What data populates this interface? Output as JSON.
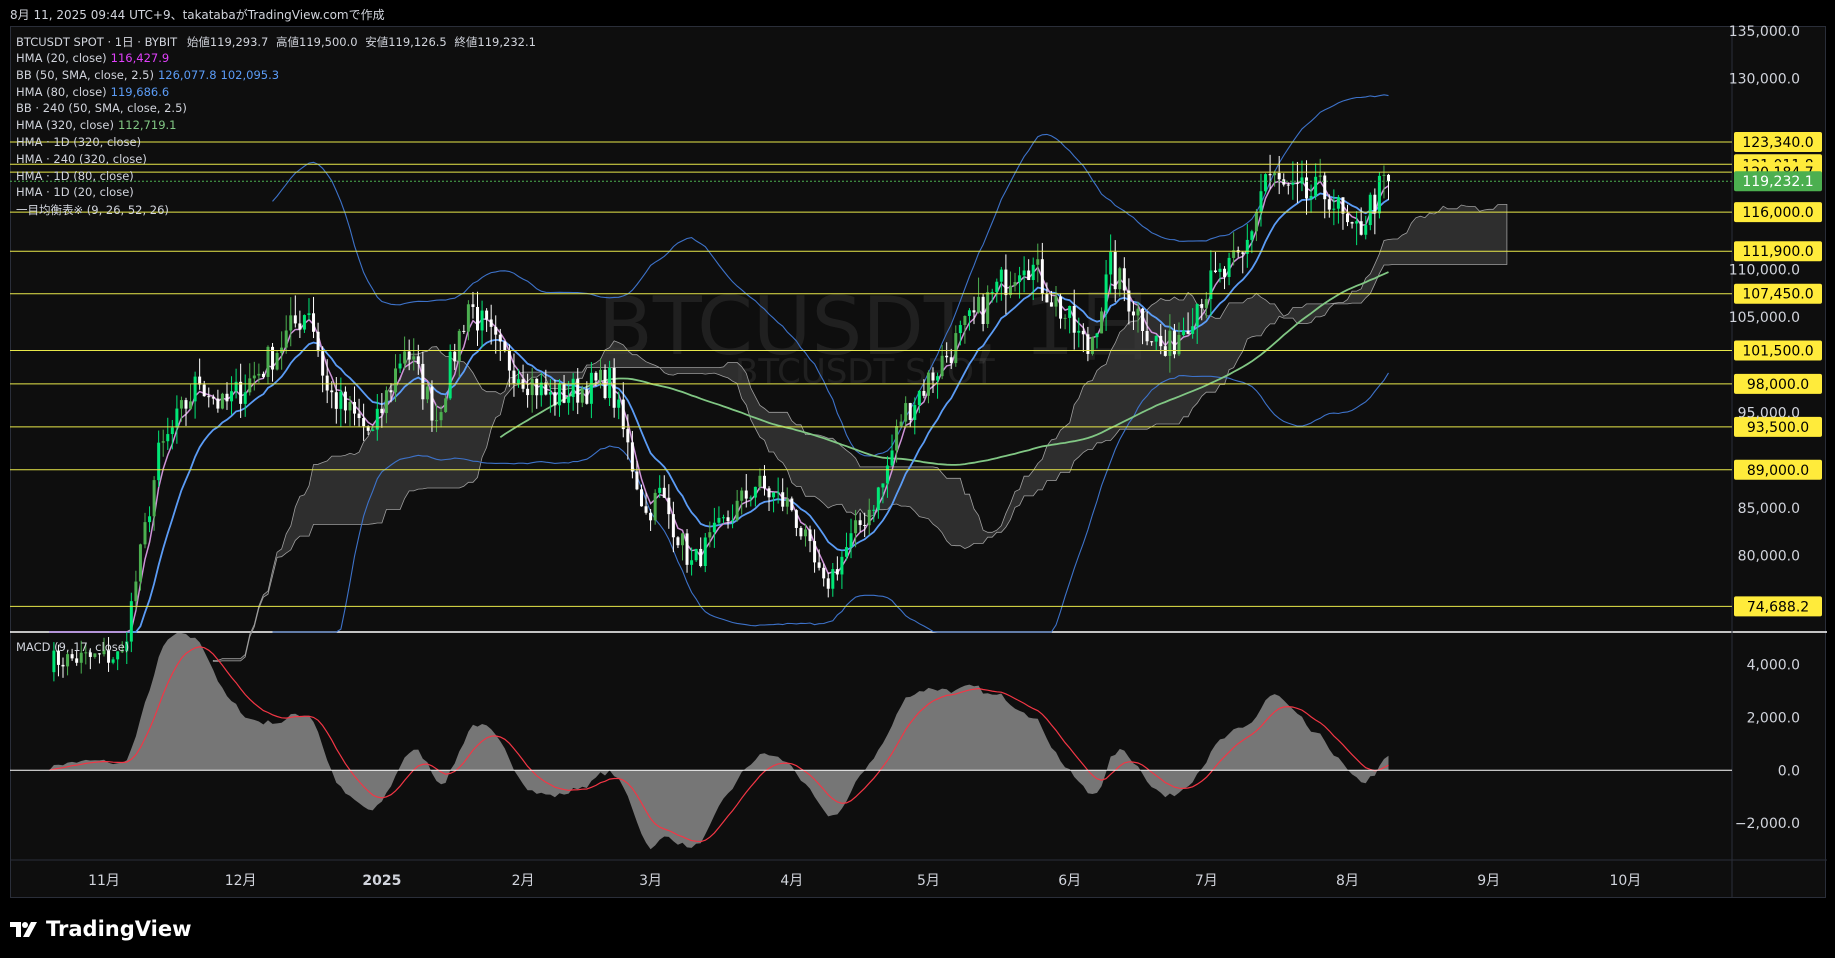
{
  "snapshot": "8月 11, 2025 09:44 UTC+9、takatabaがTradingView.comで作成",
  "symbol_line": {
    "name": "BTCUSDT SPOT · 1日 · BYBIT",
    "open_label": "始値",
    "open": "119,293.7",
    "high_label": "高値",
    "high": "119,500.0",
    "low_label": "安値",
    "low": "119,126.5",
    "close_label": "終値",
    "close": "119,232.1"
  },
  "indicators": [
    {
      "label": "HMA (20, close)",
      "values": [
        "116,427.9"
      ],
      "colors": [
        "#e040fb"
      ]
    },
    {
      "label": "BB (50, SMA, close, 2.5)",
      "values": [
        "126,077.8",
        "102,095.3"
      ],
      "colors": [
        "#5b9cf6",
        "#5b9cf6"
      ]
    },
    {
      "label": "HMA (80, close)",
      "values": [
        "119,686.6"
      ],
      "colors": [
        "#5b9cf6"
      ]
    },
    {
      "label": "BB · 240 (50, SMA, close, 2.5)",
      "values": [],
      "colors": []
    },
    {
      "label": "HMA (320, close)",
      "values": [
        "112,719.1"
      ],
      "colors": [
        "#81c784"
      ]
    },
    {
      "label": "HMA · 1D (320, close)",
      "values": [],
      "colors": []
    },
    {
      "label": "HMA · 240 (320, close)",
      "values": [],
      "colors": []
    },
    {
      "label": "HMA · 1D (80, close)",
      "values": [],
      "colors": []
    },
    {
      "label": "HMA · 1D (20, close)",
      "values": [],
      "colors": []
    },
    {
      "label": "一目均衡表※ (9, 26, 52, 26)",
      "values": [],
      "colors": []
    }
  ],
  "watermark": {
    "main": "BTCUSDT, 1日",
    "sub": "BTCUSDT SPOT"
  },
  "macd_label": "MACD (9, 17, close)",
  "brand": "TradingView",
  "colors": {
    "up": "#4caf50",
    "up_bright": "#00e676",
    "down": "#ffffff",
    "hline": "#e8e84a",
    "badge_bg": "#ffeb3b",
    "last_bg": "#4caf50",
    "hma20": "#ce93d8",
    "hma80": "#5b9cf6",
    "hma320": "#81c784",
    "bb": "#3d72c9",
    "cloud": "#3a3a3a",
    "macd_area": "#888888",
    "signal": "#f23645"
  },
  "chart_data": {
    "type": "candlestick",
    "price_axis": {
      "ylim": [
        72000,
        135500
      ],
      "ticks": [
        75000,
        80000,
        85000,
        90000,
        95000,
        100000,
        105000,
        110000,
        115000,
        120000,
        125000,
        130000,
        135000
      ],
      "tick_labels": [
        "",
        "80,000.0",
        "85,000.0",
        "",
        "95,000.0",
        "",
        "105,000.0",
        "110,000.0",
        "",
        "",
        "",
        "130,000.0",
        "135,000.0"
      ]
    },
    "x_axis": {
      "labels": [
        "11月",
        "12月",
        "2025",
        "2月",
        "3月",
        "4月",
        "5月",
        "6月",
        "7月",
        "8月",
        "9月",
        "10月"
      ],
      "label_dates": [
        "2024-11-01",
        "2024-12-01",
        "2025-01-01",
        "2025-02-01",
        "2025-03-01",
        "2025-04-01",
        "2025-05-01",
        "2025-06-01",
        "2025-07-01",
        "2025-08-01",
        "2025-09-01",
        "2025-10-01"
      ]
    },
    "horizontal_levels": [
      {
        "value": 123340,
        "label": "123,340.0"
      },
      {
        "value": 121011.8,
        "label": "121,011.8"
      },
      {
        "value": 120184.7,
        "label": "120,184.7"
      },
      {
        "value": 116000,
        "label": "116,000.0"
      },
      {
        "value": 111900,
        "label": "111,900.0"
      },
      {
        "value": 107450,
        "label": "107,450.0"
      },
      {
        "value": 101500,
        "label": "101,500.0"
      },
      {
        "value": 98000,
        "label": "98,000.0"
      },
      {
        "value": 93500,
        "label": "93,500.0"
      },
      {
        "value": 89000,
        "label": "89,000.0"
      },
      {
        "value": 74688.2,
        "label": "74,688.2"
      }
    ],
    "last_price": {
      "value": 119232.1,
      "label": "119,232.1"
    },
    "close_keypoints": [
      {
        "date": "2024-10-20",
        "close": 69000
      },
      {
        "date": "2024-11-05",
        "close": 69500
      },
      {
        "date": "2024-11-13",
        "close": 90500
      },
      {
        "date": "2024-11-22",
        "close": 98500
      },
      {
        "date": "2024-11-27",
        "close": 95500
      },
      {
        "date": "2024-12-06",
        "close": 99800
      },
      {
        "date": "2024-12-16",
        "close": 106200
      },
      {
        "date": "2024-12-20",
        "close": 97200
      },
      {
        "date": "2024-12-30",
        "close": 92600
      },
      {
        "date": "2025-01-06",
        "close": 102000
      },
      {
        "date": "2025-01-13",
        "close": 94500
      },
      {
        "date": "2025-01-20",
        "close": 106500
      },
      {
        "date": "2025-01-27",
        "close": 101000
      },
      {
        "date": "2025-02-07",
        "close": 96500
      },
      {
        "date": "2025-02-20",
        "close": 98300
      },
      {
        "date": "2025-02-28",
        "close": 84300
      },
      {
        "date": "2025-03-03",
        "close": 86500
      },
      {
        "date": "2025-03-10",
        "close": 79000
      },
      {
        "date": "2025-03-24",
        "close": 87500
      },
      {
        "date": "2025-04-01",
        "close": 85000
      },
      {
        "date": "2025-04-08",
        "close": 76500
      },
      {
        "date": "2025-04-21",
        "close": 87500
      },
      {
        "date": "2025-04-25",
        "close": 94500
      },
      {
        "date": "2025-05-08",
        "close": 103000
      },
      {
        "date": "2025-05-22",
        "close": 111500
      },
      {
        "date": "2025-06-05",
        "close": 101500
      },
      {
        "date": "2025-06-10",
        "close": 110000
      },
      {
        "date": "2025-06-22",
        "close": 101000
      },
      {
        "date": "2025-06-30",
        "close": 107500
      },
      {
        "date": "2025-07-09",
        "close": 111000
      },
      {
        "date": "2025-07-14",
        "close": 120000
      },
      {
        "date": "2025-07-20",
        "close": 117500
      },
      {
        "date": "2025-07-28",
        "close": 118000
      },
      {
        "date": "2025-08-02",
        "close": 113000
      },
      {
        "date": "2025-08-07",
        "close": 117500
      },
      {
        "date": "2025-08-10",
        "close": 119232
      }
    ],
    "macd_axis": {
      "ylim": [
        -3400,
        5200
      ],
      "ticks": [
        4000,
        2000,
        0,
        -2000
      ],
      "tick_labels": [
        "4,000.0",
        "2,000.0",
        "0.0",
        "−2,000.0"
      ]
    }
  }
}
